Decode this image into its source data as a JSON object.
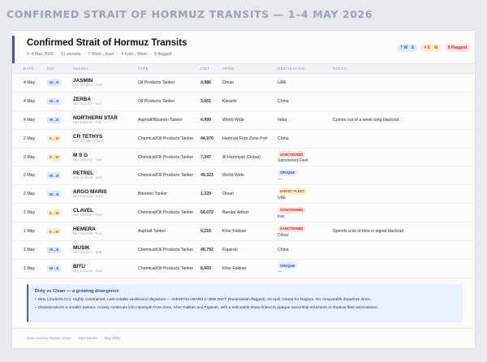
{
  "page_heading": "CONFIRMED STRAIT OF HORMUZ TRANSITS — 1–4 MAY 2026",
  "card": {
    "title": "Confirmed Strait of Hormuz Transits",
    "meta": [
      "1–4 May 2026",
      "11 vessels",
      "7 West→East",
      "4 East→West",
      "5 flagged"
    ],
    "legend": {
      "w2e": "7 W→E",
      "e2w": "4 E→W",
      "flagged": "5 Flagged"
    }
  },
  "columns": [
    "DATE",
    "DIR",
    "VESSEL",
    "TYPE",
    "DWT",
    "FROM",
    "DESTINATION",
    "NOTES"
  ],
  "rows": [
    {
      "date": "4 May",
      "dir": "W→E",
      "dir_kind": "w",
      "name": "JASMIN",
      "imo": "IMO 9178835 · CMR",
      "type": "Oil Products Tanker",
      "dwt": "4,986",
      "from": "Oman",
      "flag": "",
      "flag_kind": "",
      "dest": "UAE",
      "notes": ""
    },
    {
      "date": "4 May",
      "dir": "W→E",
      "dir_kind": "w",
      "name": "ZERBA",
      "imo": "IMO 9112707 · SLE",
      "type": "Oil Products Tanker",
      "dwt": "3,601",
      "from": "Karachi",
      "flag": "",
      "flag_kind": "",
      "dest": "China",
      "notes": ""
    },
    {
      "date": "4 May",
      "dir": "W→E",
      "dir_kind": "w",
      "name": "NORTHERN STAR",
      "imo": "IMO 9462990 · PUK",
      "type": "Asphalt/Bitumen Tanker",
      "dwt": "4,999",
      "from": "World Wide",
      "flag": "",
      "flag_kind": "",
      "dest": "India",
      "notes": "Comes out of a week-long blackout"
    },
    {
      "date": "2 May",
      "dir": "E→W",
      "dir_kind": "e",
      "name": "CR TETHYS",
      "imo": "IMO 9116590 · CMR",
      "type": "Chemical/Oil Products Tanker",
      "dwt": "44,970",
      "from": "Hamriya Free Zone Port",
      "flag": "",
      "flag_kind": "",
      "dest": "China",
      "notes": ""
    },
    {
      "date": "2 May",
      "dir": "E→W",
      "dir_kind": "e",
      "name": "M S G",
      "imo": "IMO 9469023 · GAB",
      "type": "Chemical/Oil Products Tanker",
      "dwt": "7,047",
      "from": "Al Hamriyah (Dubai)",
      "flag": "SANCTIONED",
      "flag_kind": "sanct",
      "dest": "Sanctioned Fleet",
      "notes": ""
    },
    {
      "date": "2 May",
      "dir": "W→E",
      "dir_kind": "w",
      "name": "PETREL",
      "imo": "IMO 9078426 · HKG",
      "type": "Chemical/Oil Products Tanker",
      "dwt": "49,323",
      "from": "World Wide",
      "flag": "OPAQUE",
      "flag_kind": "opaque",
      "dest": "—",
      "notes": ""
    },
    {
      "date": "2 May",
      "dir": "W→E",
      "dir_kind": "w",
      "name": "ARGO MARIS",
      "imo": "IMO 9041645 · COM",
      "type": "Bitumen Tanker",
      "dwt": "1,229",
      "from": "Oman",
      "flag": "GHOST FLEET",
      "flag_kind": "ghost",
      "dest": "UAE",
      "notes": ""
    },
    {
      "date": "1 May",
      "dir": "E→W",
      "dir_kind": "e",
      "name": "CLAVEL",
      "imo": "IMO 9062932 · PAN",
      "type": "Chemical/Oil Products Tanker",
      "dwt": "50,072",
      "from": "Bandar Abbas",
      "flag": "SANCTIONED",
      "flag_kind": "sanct",
      "dest": "Iran",
      "notes": ""
    },
    {
      "date": "1 May",
      "dir": "E→W",
      "dir_kind": "e",
      "name": "HEMERA",
      "imo": "IMO 9264934 · PUK",
      "type": "Asphalt Tanker",
      "dwt": "9,215",
      "from": "Khor Fakkan",
      "flag": "SANCTIONED",
      "flag_kind": "sanct",
      "dest": "China",
      "notes": "Spends a lot of time in signal blackout"
    },
    {
      "date": "1 May",
      "dir": "W→E",
      "dir_kind": "w",
      "name": "MUSIK",
      "imo": "IMO 9363031 · BRB",
      "type": "Chemical/Oil Products Tanker",
      "dwt": "46,792",
      "from": "Fujairah",
      "flag": "",
      "flag_kind": "",
      "dest": "China",
      "notes": ""
    },
    {
      "date": "1 May",
      "dir": "W→E",
      "dir_kind": "w",
      "name": "BITU",
      "imo": "IMO 9031785 · PAN",
      "type": "Chemical/Oil Products Tanker",
      "dwt": "8,603",
      "from": "Khor Fakkan",
      "flag": "OPAQUE",
      "flag_kind": "opaque",
      "dest": "—",
      "notes": ""
    }
  ],
  "callout": {
    "title": "Dirty vs Clean — a growing divergence",
    "items": [
      "Dirty (crude/VLCC): Highly constrained. Last notable westbound departure — IDEMITSU MARU (~300k DWT, Panamanian-flagged), 28 April, bound for Nagoya. No comparable departure since.",
      "Clean/products & smaller tankers: Activity continues into Hamriyah Free Zone, Khor Fakkan and Fujairah, with a noticeable share linked to opaque ownership structures or shadow fleet associations."
    ]
  },
  "footer": [
    "Data sources: Signal Ocean",
    "S&S Marine",
    "May 2026"
  ]
}
